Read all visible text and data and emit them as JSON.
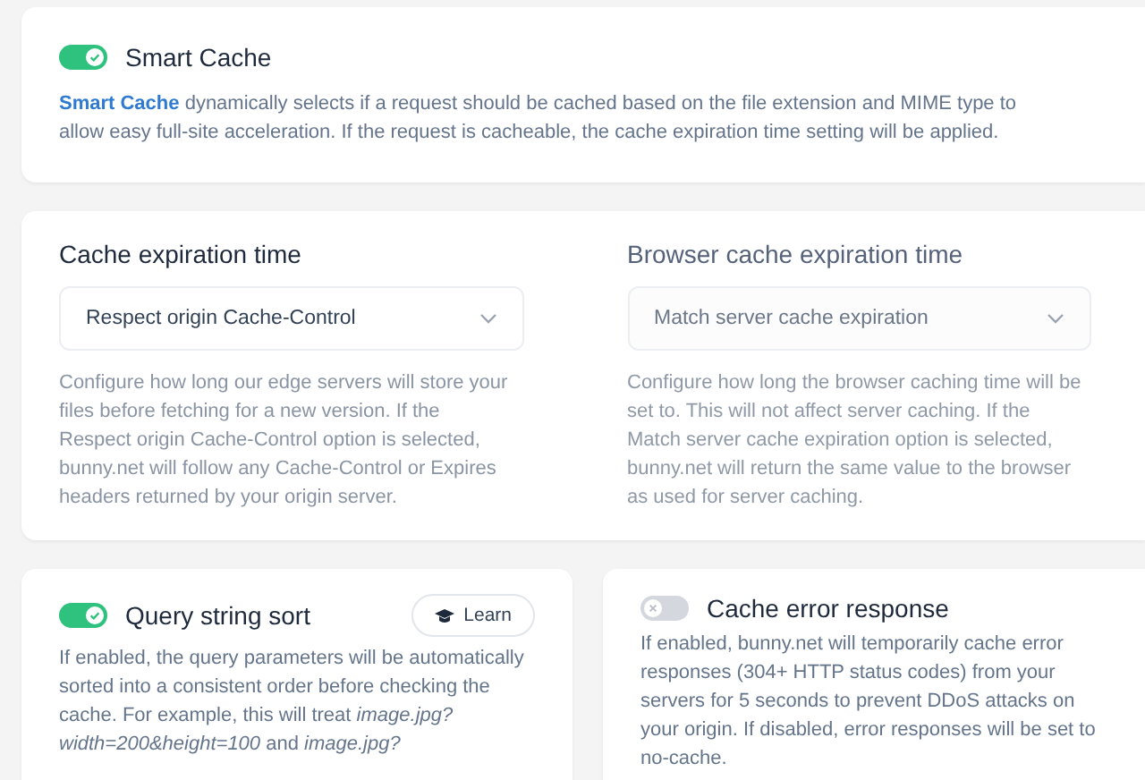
{
  "smart_cache": {
    "title": "Smart Cache",
    "on": true,
    "description": "**Smart Cache** dynamically selects if a request should be cached based on the file extension and MIME type to allow easy full-site acceleration. If the request is cacheable, the cache expiration time setting will be applied."
  },
  "expiration": [
    {
      "title": "Cache expiration time",
      "value": "Respect origin Cache-Control",
      "disabled": false,
      "description": "Configure how long our edge servers will store your files before fetching for a new version. If the Respect origin Cache-Control option is selected, bunny.net will follow any Cache-Control or Expires headers returned by your origin server."
    },
    {
      "title": "Browser cache expiration time",
      "value": "Match server cache expiration",
      "disabled": true,
      "description": "Configure how long the browser caching time will be set to. This will not affect server caching. If the Match server cache expiration option is selected, bunny.net will return the same value to the browser as used for server caching."
    }
  ],
  "features": [
    {
      "title": "Query string sort",
      "on": true,
      "learn": "Learn",
      "description": "If enabled, the query parameters will be automatically sorted into a consistent order before checking the cache. For example, this will treat *image.jpg?width=200&height=100* and *image.jpg?*"
    },
    {
      "title": "Cache error response",
      "on": false,
      "description": "If enabled, bunny.net will temporarily cache error responses (304+ HTTP status codes) from your servers for 5 seconds to prevent DDoS attacks on your origin. If disabled, error responses will be set to no-cache."
    }
  ]
}
